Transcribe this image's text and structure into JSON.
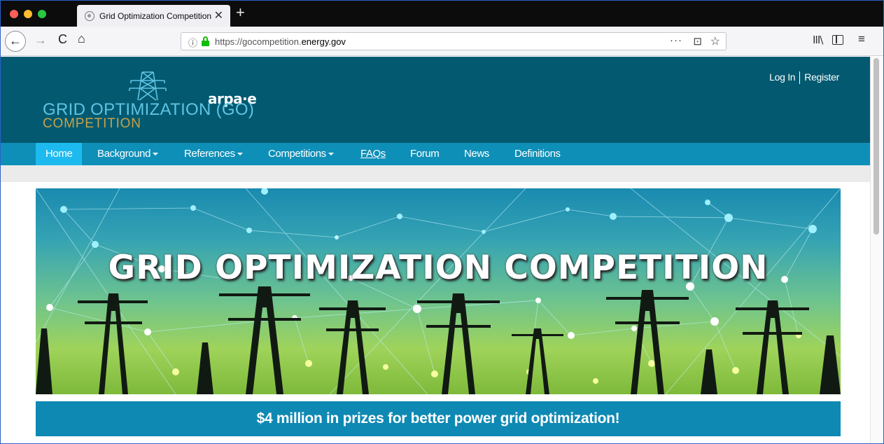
{
  "browser": {
    "tab_title": "Grid Optimization Competition",
    "tab_close": "✕",
    "new_tab": "+",
    "url_prefix": "https://gocompetition.",
    "url_domain": "energy.gov",
    "info_icon": "ⓘ",
    "more": "···",
    "pocket": "⊡",
    "star": "☆",
    "back": "←",
    "forward": "→",
    "reload": "C",
    "home": "⌂",
    "library": "III\\",
    "menu": "≡"
  },
  "header": {
    "logo_arpa": "arpa·e",
    "logo_line1": "GRID OPTIMIZATION (GO)",
    "logo_line2": "COMPETITION",
    "login": "Log In",
    "register": "Register"
  },
  "nav": [
    {
      "label": "Home",
      "dropdown": false
    },
    {
      "label": "Background",
      "dropdown": true
    },
    {
      "label": "References",
      "dropdown": true
    },
    {
      "label": "Competitions",
      "dropdown": true
    },
    {
      "label": "FAQs",
      "dropdown": false
    },
    {
      "label": "Forum",
      "dropdown": false
    },
    {
      "label": "News",
      "dropdown": false
    },
    {
      "label": "Definitions",
      "dropdown": false
    }
  ],
  "hero": {
    "title": "GRID OPTIMIZATION COMPETITION"
  },
  "prize": {
    "text": "$4 million in prizes for better power grid optimization!"
  },
  "colors": {
    "header_bg": "#035a70",
    "nav_bg": "#0e8fb8",
    "nav_active": "#1dbaef",
    "prize_bg": "#0e89b3",
    "logo_blue": "#5fc3e4",
    "logo_gold": "#c9a04a"
  },
  "icons": {
    "back": "back-arrow-icon",
    "forward": "forward-arrow-icon",
    "reload": "reload-icon",
    "home": "home-icon",
    "lock": "lock-icon",
    "info": "info-icon",
    "more": "more-icon",
    "pocket": "pocket-icon",
    "star": "bookmark-star-icon",
    "library": "library-icon",
    "sidebar": "sidebar-icon",
    "menu": "hamburger-menu-icon",
    "tower": "power-tower-icon"
  }
}
